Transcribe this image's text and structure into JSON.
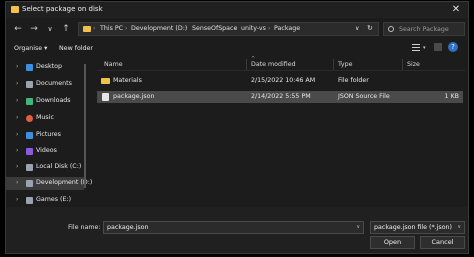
{
  "window": {
    "title": "Select package on disk",
    "close_glyph": "✕"
  },
  "nav_buttons": {
    "back": "←",
    "forward": "→",
    "recent": "∨",
    "up": "↑"
  },
  "address": {
    "crumbs": [
      "This PC",
      "Development (D:)",
      "SenseOfSpace",
      "unity-vs",
      "Package"
    ],
    "dropdown": "∨",
    "refresh": "↻"
  },
  "search": {
    "placeholder": "Search Package"
  },
  "toolbar": {
    "organise": "Organise ▾",
    "new_folder": "New folder"
  },
  "view_controls": {
    "help": "?"
  },
  "nav_pane": {
    "items": [
      {
        "label": "Desktop",
        "color": "#3b8ee0"
      },
      {
        "label": "Documents",
        "color": "#9aa3b0"
      },
      {
        "label": "Downloads",
        "color": "#3fb67b"
      },
      {
        "label": "Music",
        "color": "#e0603b"
      },
      {
        "label": "Pictures",
        "color": "#3b8ee0"
      },
      {
        "label": "Videos",
        "color": "#8a5be0"
      },
      {
        "label": "Local Disk (C:)",
        "color": "#9aa3b0"
      },
      {
        "label": "Development (D:)",
        "color": "#9aa3b0"
      },
      {
        "label": "Games (E:)",
        "color": "#9aa3b0"
      }
    ]
  },
  "columns": {
    "name": "Name",
    "date": "Date modified",
    "type": "Type",
    "size": "Size"
  },
  "files": [
    {
      "name": "Materials",
      "date": "2/15/2022 10:46 AM",
      "type": "File folder",
      "size": "",
      "kind": "folder"
    },
    {
      "name": "package.json",
      "date": "2/14/2022 5:55 PM",
      "type": "JSON Source File",
      "size": "1 KB",
      "kind": "file"
    }
  ],
  "footer": {
    "file_name_label": "File name:",
    "file_name_value": "package.json",
    "file_type_value": "package.json file (*.json)",
    "open_label": "Open",
    "cancel_label": "Cancel"
  },
  "colors": {
    "accent_folder": "#f0c24a",
    "selection": "#4a4a4a"
  }
}
